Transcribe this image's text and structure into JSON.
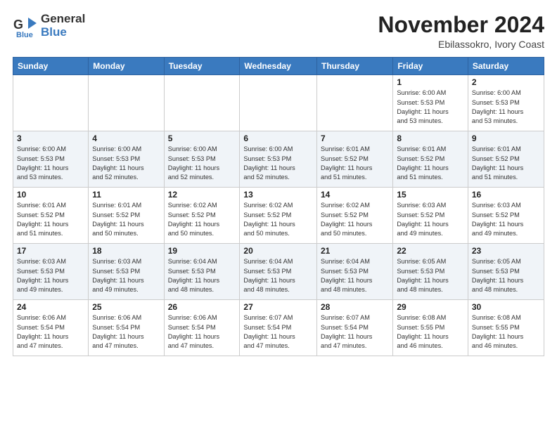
{
  "logo": {
    "general": "General",
    "blue": "Blue"
  },
  "title": "November 2024",
  "location": "Ebilassokro, Ivory Coast",
  "days_header": [
    "Sunday",
    "Monday",
    "Tuesday",
    "Wednesday",
    "Thursday",
    "Friday",
    "Saturday"
  ],
  "weeks": [
    [
      {
        "day": "",
        "info": ""
      },
      {
        "day": "",
        "info": ""
      },
      {
        "day": "",
        "info": ""
      },
      {
        "day": "",
        "info": ""
      },
      {
        "day": "",
        "info": ""
      },
      {
        "day": "1",
        "info": "Sunrise: 6:00 AM\nSunset: 5:53 PM\nDaylight: 11 hours\nand 53 minutes."
      },
      {
        "day": "2",
        "info": "Sunrise: 6:00 AM\nSunset: 5:53 PM\nDaylight: 11 hours\nand 53 minutes."
      }
    ],
    [
      {
        "day": "3",
        "info": "Sunrise: 6:00 AM\nSunset: 5:53 PM\nDaylight: 11 hours\nand 53 minutes."
      },
      {
        "day": "4",
        "info": "Sunrise: 6:00 AM\nSunset: 5:53 PM\nDaylight: 11 hours\nand 52 minutes."
      },
      {
        "day": "5",
        "info": "Sunrise: 6:00 AM\nSunset: 5:53 PM\nDaylight: 11 hours\nand 52 minutes."
      },
      {
        "day": "6",
        "info": "Sunrise: 6:00 AM\nSunset: 5:53 PM\nDaylight: 11 hours\nand 52 minutes."
      },
      {
        "day": "7",
        "info": "Sunrise: 6:01 AM\nSunset: 5:52 PM\nDaylight: 11 hours\nand 51 minutes."
      },
      {
        "day": "8",
        "info": "Sunrise: 6:01 AM\nSunset: 5:52 PM\nDaylight: 11 hours\nand 51 minutes."
      },
      {
        "day": "9",
        "info": "Sunrise: 6:01 AM\nSunset: 5:52 PM\nDaylight: 11 hours\nand 51 minutes."
      }
    ],
    [
      {
        "day": "10",
        "info": "Sunrise: 6:01 AM\nSunset: 5:52 PM\nDaylight: 11 hours\nand 51 minutes."
      },
      {
        "day": "11",
        "info": "Sunrise: 6:01 AM\nSunset: 5:52 PM\nDaylight: 11 hours\nand 50 minutes."
      },
      {
        "day": "12",
        "info": "Sunrise: 6:02 AM\nSunset: 5:52 PM\nDaylight: 11 hours\nand 50 minutes."
      },
      {
        "day": "13",
        "info": "Sunrise: 6:02 AM\nSunset: 5:52 PM\nDaylight: 11 hours\nand 50 minutes."
      },
      {
        "day": "14",
        "info": "Sunrise: 6:02 AM\nSunset: 5:52 PM\nDaylight: 11 hours\nand 50 minutes."
      },
      {
        "day": "15",
        "info": "Sunrise: 6:03 AM\nSunset: 5:52 PM\nDaylight: 11 hours\nand 49 minutes."
      },
      {
        "day": "16",
        "info": "Sunrise: 6:03 AM\nSunset: 5:52 PM\nDaylight: 11 hours\nand 49 minutes."
      }
    ],
    [
      {
        "day": "17",
        "info": "Sunrise: 6:03 AM\nSunset: 5:53 PM\nDaylight: 11 hours\nand 49 minutes."
      },
      {
        "day": "18",
        "info": "Sunrise: 6:03 AM\nSunset: 5:53 PM\nDaylight: 11 hours\nand 49 minutes."
      },
      {
        "day": "19",
        "info": "Sunrise: 6:04 AM\nSunset: 5:53 PM\nDaylight: 11 hours\nand 48 minutes."
      },
      {
        "day": "20",
        "info": "Sunrise: 6:04 AM\nSunset: 5:53 PM\nDaylight: 11 hours\nand 48 minutes."
      },
      {
        "day": "21",
        "info": "Sunrise: 6:04 AM\nSunset: 5:53 PM\nDaylight: 11 hours\nand 48 minutes."
      },
      {
        "day": "22",
        "info": "Sunrise: 6:05 AM\nSunset: 5:53 PM\nDaylight: 11 hours\nand 48 minutes."
      },
      {
        "day": "23",
        "info": "Sunrise: 6:05 AM\nSunset: 5:53 PM\nDaylight: 11 hours\nand 48 minutes."
      }
    ],
    [
      {
        "day": "24",
        "info": "Sunrise: 6:06 AM\nSunset: 5:54 PM\nDaylight: 11 hours\nand 47 minutes."
      },
      {
        "day": "25",
        "info": "Sunrise: 6:06 AM\nSunset: 5:54 PM\nDaylight: 11 hours\nand 47 minutes."
      },
      {
        "day": "26",
        "info": "Sunrise: 6:06 AM\nSunset: 5:54 PM\nDaylight: 11 hours\nand 47 minutes."
      },
      {
        "day": "27",
        "info": "Sunrise: 6:07 AM\nSunset: 5:54 PM\nDaylight: 11 hours\nand 47 minutes."
      },
      {
        "day": "28",
        "info": "Sunrise: 6:07 AM\nSunset: 5:54 PM\nDaylight: 11 hours\nand 47 minutes."
      },
      {
        "day": "29",
        "info": "Sunrise: 6:08 AM\nSunset: 5:55 PM\nDaylight: 11 hours\nand 46 minutes."
      },
      {
        "day": "30",
        "info": "Sunrise: 6:08 AM\nSunset: 5:55 PM\nDaylight: 11 hours\nand 46 minutes."
      }
    ]
  ]
}
